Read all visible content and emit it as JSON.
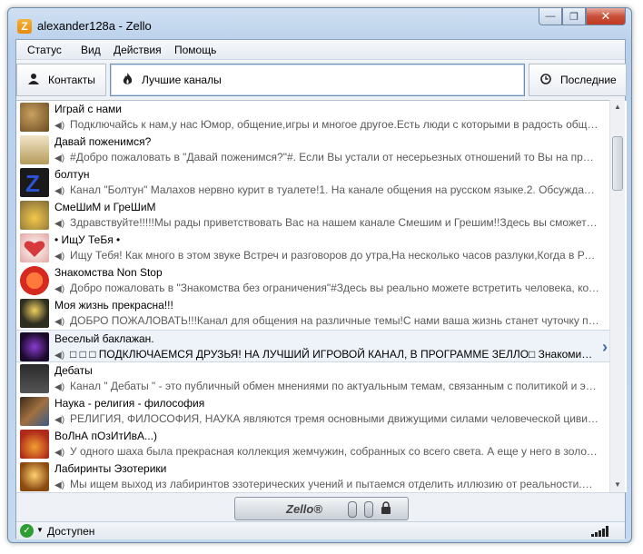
{
  "window": {
    "title": "alexander128a - Zello",
    "app_icon": "Z",
    "buttons": {
      "minimize": "—",
      "maximize": "❐",
      "close": "✕"
    }
  },
  "menu": [
    "Статус",
    "Вид",
    "Действия",
    "Помощь"
  ],
  "tabs": {
    "contacts": {
      "label": "Контакты",
      "icon": "person-icon"
    },
    "channels": {
      "label": "Лучшие каналы",
      "icon": "flame-icon"
    },
    "recents": {
      "label": "Последние",
      "icon": "clock-icon"
    }
  },
  "channels": [
    {
      "name": "Играй с нами",
      "desc": "Подключайсь к нам,у нас Юмор, общение,игры и многое другое.Есть люди с которыми в радость общаться.",
      "avatar_color": "#b9b07a"
    },
    {
      "name": "Давай поженимся?",
      "desc": "#Добро пожаловать в \"Давай поженимся?\"#. Если Вы устали от несерьезных отношений то Вы на правильном канале.",
      "avatar_color": "#d9c9a0"
    },
    {
      "name": "болтун",
      "desc": "Канал \"Болтун\" Малахов нервно курит в туалете!1. На канале общения на русском языке.2. Обсуждать разное.",
      "avatar_color": "#1f3c9c"
    },
    {
      "name": "СмеШиМ и ГреШиМ",
      "desc": "Здравствуйте!!!!!Мы рады приветствовать Вас на нашем  канале Смешим и Грешим!!Здесь вы сможете на нашем канале.",
      "avatar_color": "#c7a253"
    },
    {
      "name": "• ИщУ ТеБя •",
      "desc": "Ищу Тебя! Как много в этом звуке Встреч и разговоров до утра,На несколько часов разлуки,Когда в Реальности.",
      "avatar_color": "#e8b8b0"
    },
    {
      "name": "Знакомства Non Stop",
      "desc": "Добро пожаловать в \"Знакомства без ограничения\"#Здесь вы реально можете встретить человека, которого ищете.",
      "avatar_color": "#e0452e"
    },
    {
      "name": "Моя жизнь прекрасна!!!",
      "desc": "ДОБРО ПОЖАЛОВАТЬ!!!Канал для общения на различные темы!С нами ваша жизнь станет чуточку прекраснее.",
      "avatar_color": "#2d2d20"
    },
    {
      "name": "Веселый баклажан.",
      "desc": "□ □ □ ПОДКЛЮЧАЕМСЯ  ДРУЗЬЯ! НА ЛУЧШИЙ ИГРОВОЙ КАНАЛ, В ПРОГРАММЕ ЗЕЛЛО□ Знакомимся.",
      "avatar_color": "#5a2a8a",
      "selected": true
    },
    {
      "name": "Дебаты",
      "desc": "Канал \" Дебаты \" - это публичный обмен мнениями по актуальным темам, связанным с политикой и экономикой.",
      "avatar_color": "#3a3a3a"
    },
    {
      "name": "Наука - религия - философия",
      "desc": "РЕЛИГИЯ, ФИЛОСОФИЯ, НАУКА являются тремя основными движущими силами человеческой цивилизации.",
      "avatar_color": "#6a4a2a"
    },
    {
      "name": "ВоЛнА пОзИтИвА...)",
      "desc": "У одного шаха была прекрасная коллекция жемчужин, собранных со всего света. А еще у него в золотой шкатулке.",
      "avatar_color": "#c0402a"
    },
    {
      "name": "Лабиринты Эзотерики",
      "desc": "Мы ищем выход из лабиринтов эзотерических учений и пытаемся отделить иллюзию от реальности.Подключайтесь.",
      "avatar_color": "#b07a20"
    }
  ],
  "ptt": {
    "logo": "Zello®",
    "lock_icon": "lock-icon"
  },
  "status": {
    "label": "Доступен",
    "icon": "checkmark-icon"
  }
}
